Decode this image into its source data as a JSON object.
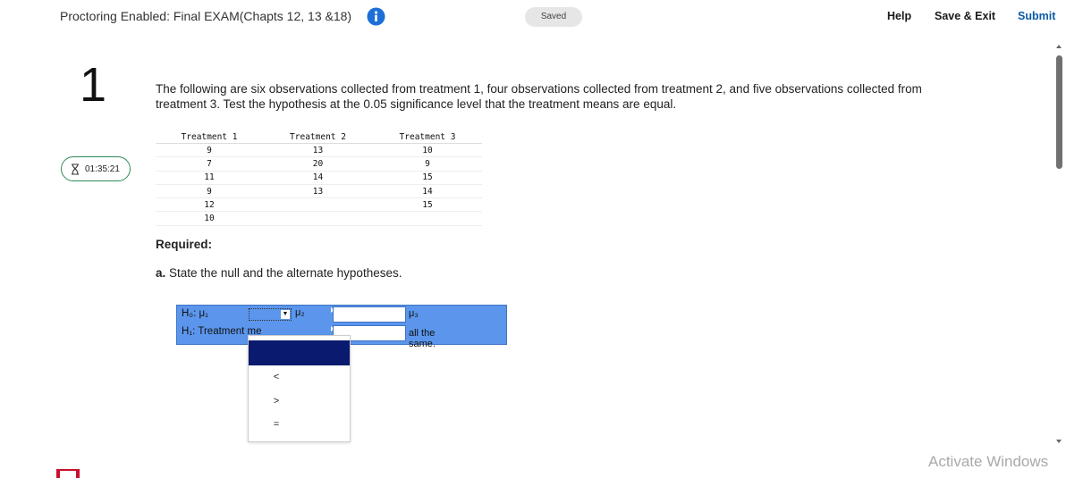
{
  "header": {
    "exam_title": "Proctoring Enabled: Final EXAM(Chapts 12, 13 &18)",
    "saved_status": "Saved",
    "help_label": "Help",
    "save_exit_label": "Save & Exit",
    "submit_label": "Submit"
  },
  "sidebar": {
    "question_number": "1",
    "timer": "01:35:21"
  },
  "question": {
    "text": "The following are six observations collected from treatment 1, four observations collected from treatment 2, and five observations collected from treatment 3. Test the hypothesis at the 0.05 significance level that the treatment means are equal."
  },
  "table": {
    "headers": [
      "Treatment 1",
      "Treatment 2",
      "Treatment 3"
    ],
    "rows": [
      [
        "9",
        "13",
        "10"
      ],
      [
        "7",
        "20",
        "9"
      ],
      [
        "11",
        "14",
        "15"
      ],
      [
        "9",
        "13",
        "14"
      ],
      [
        "12",
        "",
        "15"
      ],
      [
        "10",
        "",
        ""
      ]
    ]
  },
  "required_label": "Required:",
  "part_a": {
    "letter": "a.",
    "text": "State the null and the alternate hypotheses."
  },
  "hypotheses": {
    "h0_label": "H₀: μ₁",
    "mu2": "μ₂",
    "mu3": "μ₃",
    "h1_label": "H₁: Treatment me",
    "h1_suffix": "all the same."
  },
  "dropdown": {
    "options": [
      "<",
      ">",
      "="
    ]
  },
  "watermark": "Activate Windows",
  "colors": {
    "accent": "#5b96ec",
    "selected_option": "#0a1a6e",
    "submit": "#0b5aa8",
    "timer_border": "#2e8b57"
  }
}
